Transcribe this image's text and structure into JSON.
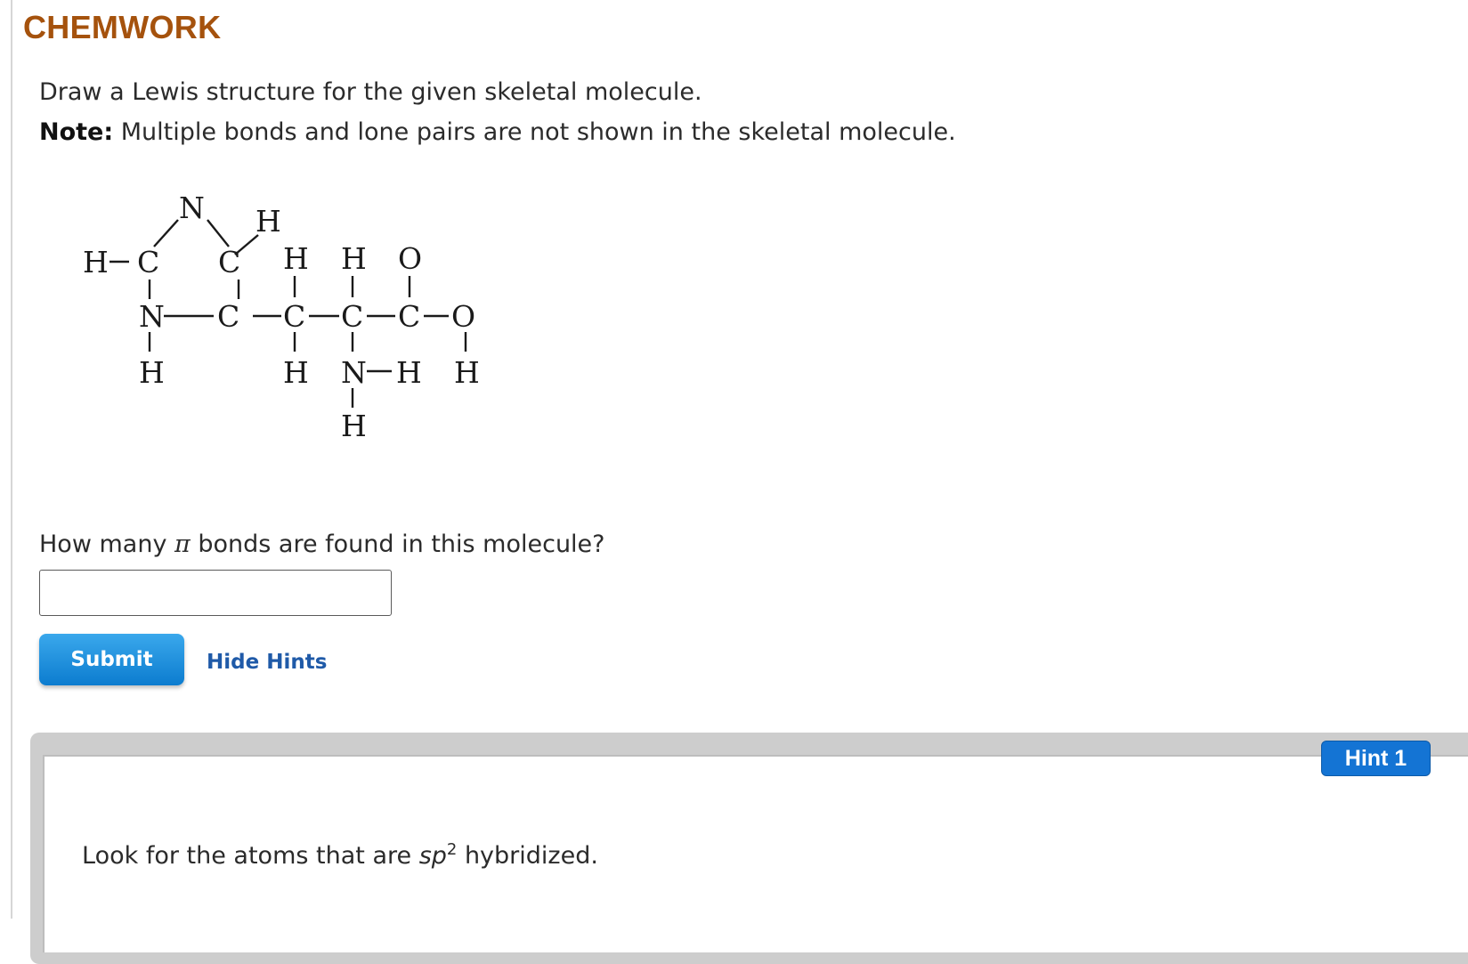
{
  "header": {
    "brand": "CHEMWORK"
  },
  "instructions": {
    "line1": "Draw a Lewis structure for the given skeletal molecule.",
    "note_label": "Note:",
    "note_text": " Multiple bonds and lone pairs are not shown in the skeletal molecule."
  },
  "molecule": {
    "atoms": {
      "n_ring": "N",
      "h_top": "H",
      "h_left": "H",
      "c_ring1": "C",
      "c_ring2": "C",
      "h_c3": "H",
      "h_c4": "H",
      "o_top": "O",
      "n_mid": "N",
      "c_mid": "C",
      "c3": "C",
      "c4": "C",
      "c5": "C",
      "o_right": "O",
      "h_nmid": "H",
      "h_c3b": "H",
      "n_c4": "N",
      "h_n1": "H",
      "h_o": "H",
      "h_n2": "H"
    }
  },
  "question": {
    "prefix": "How many ",
    "pi_symbol": "π",
    "suffix": " bonds are found in this molecule?",
    "input_value": ""
  },
  "buttons": {
    "submit": "Submit",
    "hide_hints": "Hide Hints"
  },
  "hint": {
    "tab_label": "Hint 1",
    "text_before": "Look for the atoms that are ",
    "sp": "sp",
    "superscript": "2",
    "text_after": " hybridized."
  }
}
